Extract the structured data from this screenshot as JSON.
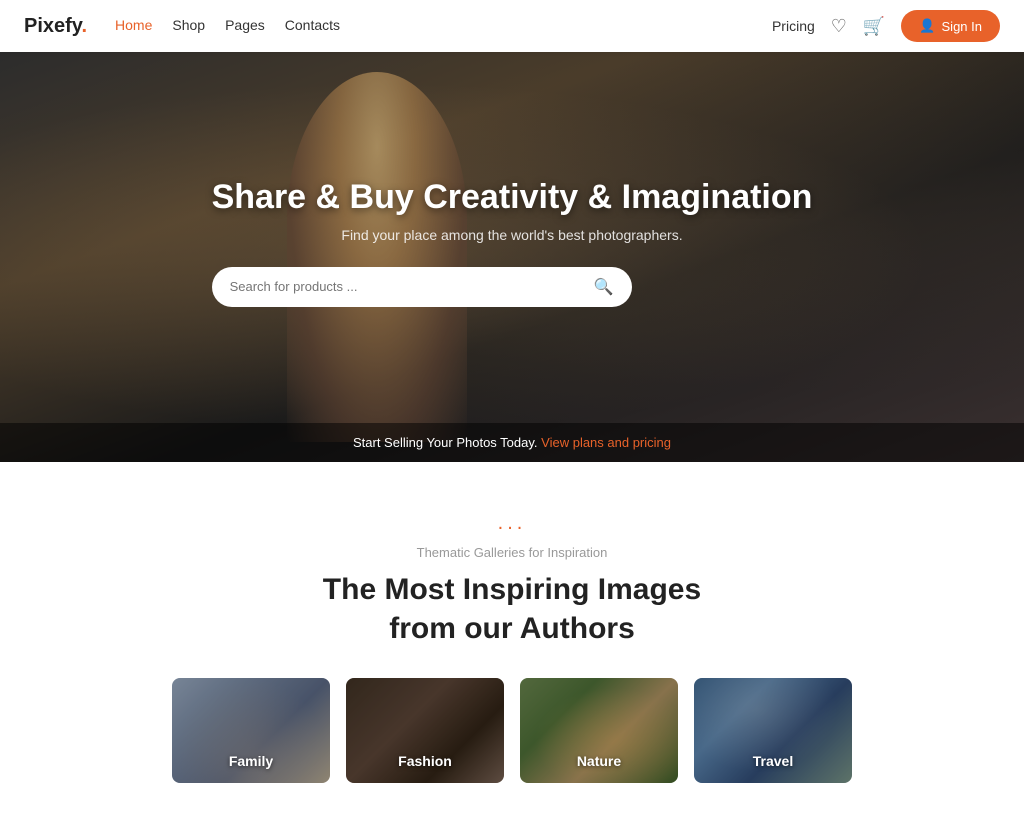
{
  "navbar": {
    "logo": "Pixefy",
    "logo_dot": ".",
    "nav_links": [
      {
        "label": "Home",
        "active": true
      },
      {
        "label": "Shop",
        "active": false
      },
      {
        "label": "Pages",
        "active": false
      },
      {
        "label": "Contacts",
        "active": false
      }
    ],
    "pricing_label": "Pricing",
    "signin_label": "Sign In"
  },
  "hero": {
    "title": "Share & Buy Creativity & Imagination",
    "subtitle": "Find your place among the world's best photographers.",
    "search_placeholder": "Search for products ...",
    "strip_text": "Start Selling Your Photos Today.",
    "strip_link": "View plans and pricing"
  },
  "gallery": {
    "dots": "...",
    "subtitle": "Thematic Galleries for Inspiration",
    "title_line1": "The Most Inspiring Images",
    "title_line2": "from our Authors",
    "cards": [
      {
        "label": "Family",
        "class": "card-family"
      },
      {
        "label": "Fashion",
        "class": "card-fashion"
      },
      {
        "label": "Nature",
        "class": "card-nature"
      },
      {
        "label": "Travel",
        "class": "card-travel"
      }
    ]
  }
}
